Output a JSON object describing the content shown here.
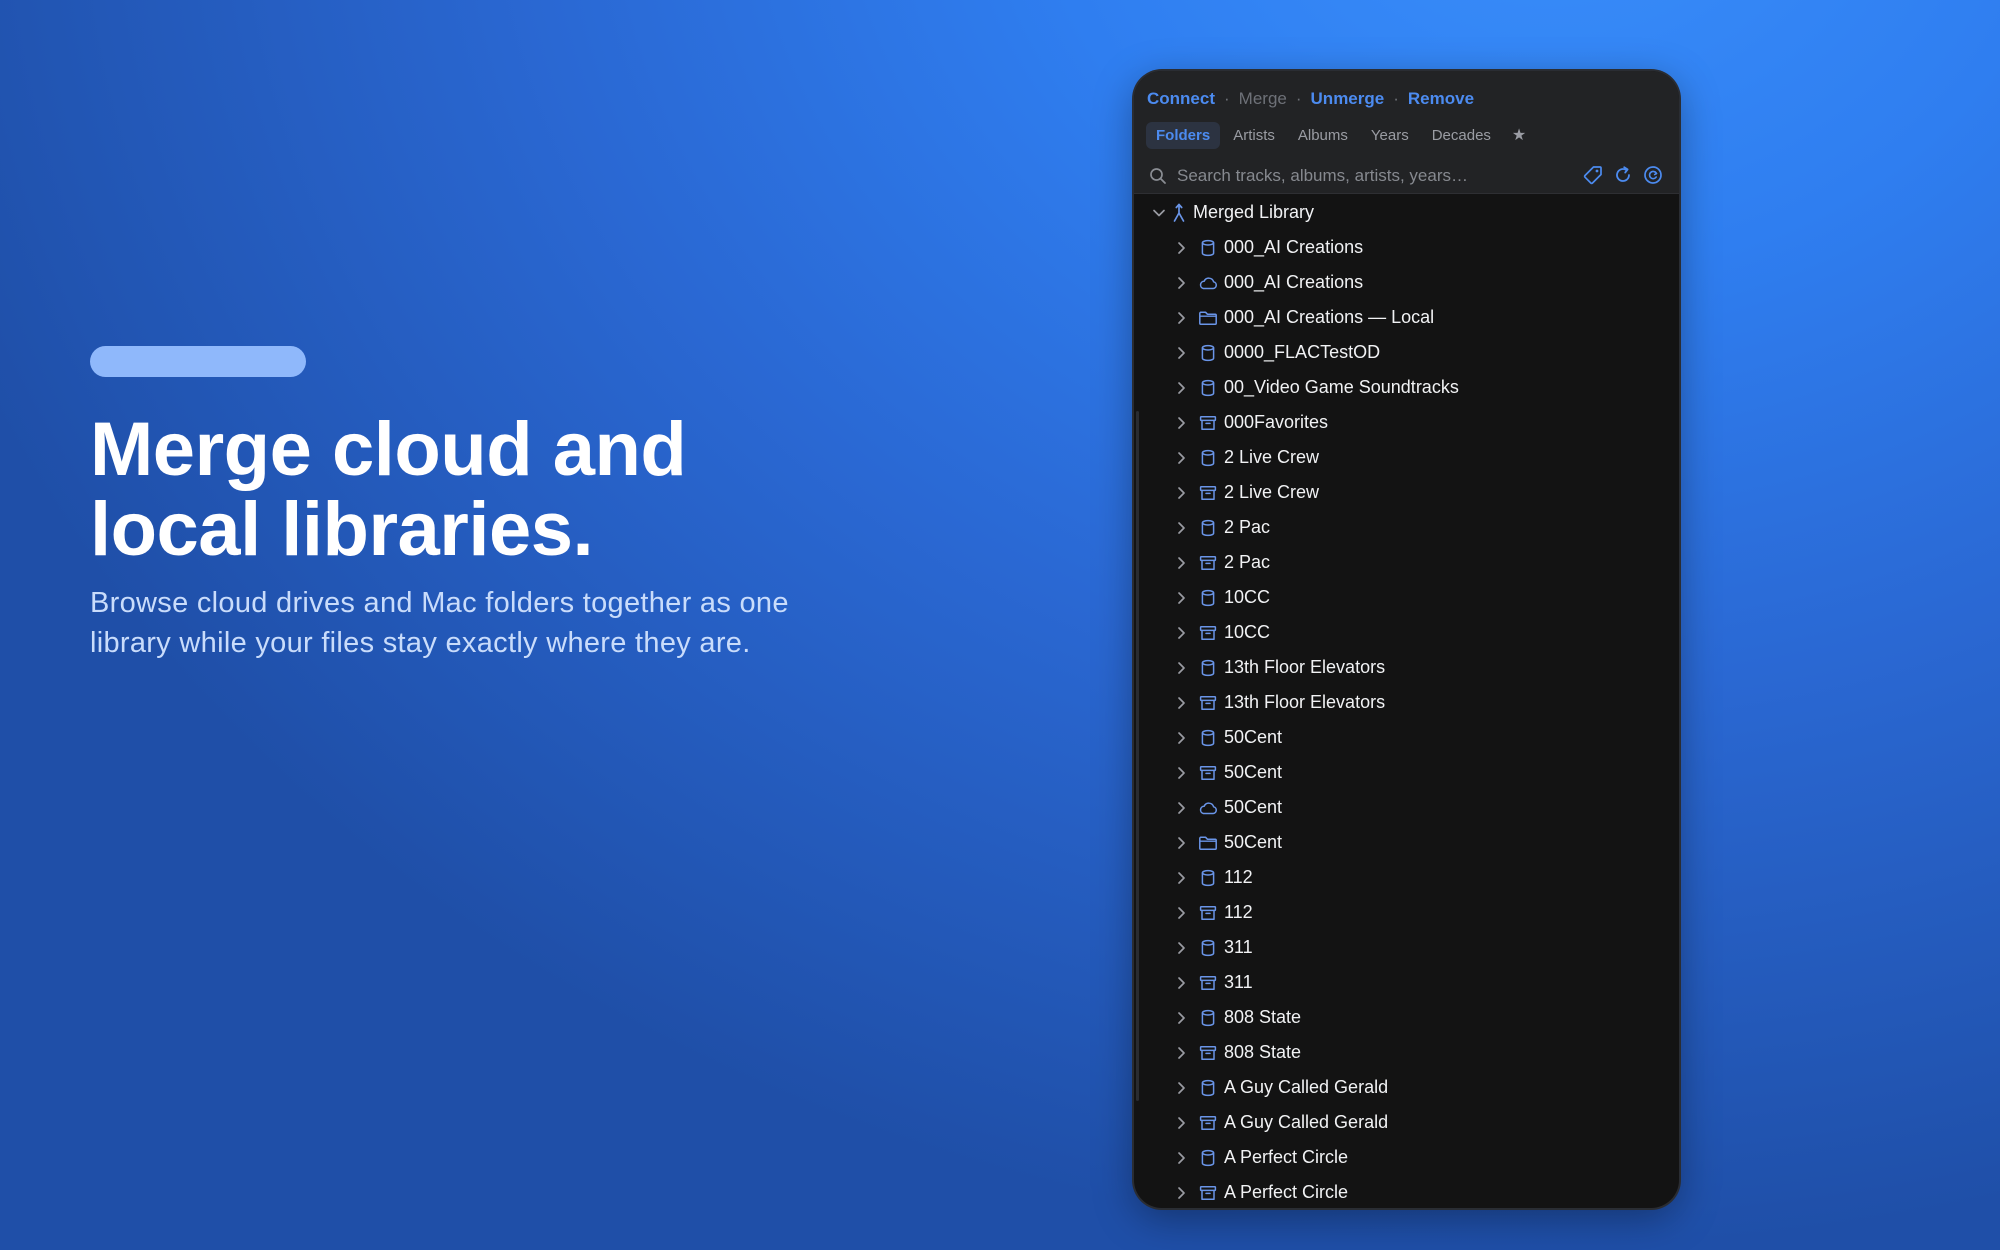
{
  "hero": {
    "title_line1": "Merge cloud and",
    "title_line2": "local libraries.",
    "subtitle": "Browse cloud drives and Mac folders together as one library while your files stay exactly where they are."
  },
  "panel": {
    "actions": {
      "connect": "Connect",
      "merge": "Merge",
      "unmerge": "Unmerge",
      "remove": "Remove",
      "separator": "·"
    },
    "tabs": [
      {
        "label": "Folders",
        "active": true
      },
      {
        "label": "Artists",
        "active": false
      },
      {
        "label": "Albums",
        "active": false
      },
      {
        "label": "Years",
        "active": false
      },
      {
        "label": "Decades",
        "active": false
      }
    ],
    "favorites_tab": "★",
    "search": {
      "placeholder": "Search tracks, albums, artists, years…",
      "value": ""
    },
    "tree": {
      "root_label": "Merged Library",
      "root_icon": "merge-icon",
      "items": [
        {
          "label": "000_AI Creations",
          "icon": "database"
        },
        {
          "label": "000_AI Creations",
          "icon": "cloud"
        },
        {
          "label": "000_AI Creations — Local",
          "icon": "folder"
        },
        {
          "label": "0000_FLACTestOD",
          "icon": "database"
        },
        {
          "label": "00_Video Game Soundtracks",
          "icon": "database"
        },
        {
          "label": "000Favorites",
          "icon": "archive"
        },
        {
          "label": "2 Live Crew",
          "icon": "database"
        },
        {
          "label": "2 Live Crew",
          "icon": "archive"
        },
        {
          "label": "2 Pac",
          "icon": "database"
        },
        {
          "label": "2 Pac",
          "icon": "archive"
        },
        {
          "label": "10CC",
          "icon": "database"
        },
        {
          "label": "10CC",
          "icon": "archive"
        },
        {
          "label": "13th Floor Elevators",
          "icon": "database"
        },
        {
          "label": "13th Floor Elevators",
          "icon": "archive"
        },
        {
          "label": "50Cent",
          "icon": "database"
        },
        {
          "label": "50Cent",
          "icon": "archive"
        },
        {
          "label": "50Cent",
          "icon": "cloud"
        },
        {
          "label": "50Cent",
          "icon": "folder"
        },
        {
          "label": "112",
          "icon": "database"
        },
        {
          "label": "112",
          "icon": "archive"
        },
        {
          "label": "311",
          "icon": "database"
        },
        {
          "label": "311",
          "icon": "archive"
        },
        {
          "label": "808 State",
          "icon": "database"
        },
        {
          "label": "808 State",
          "icon": "archive"
        },
        {
          "label": "A Guy Called Gerald",
          "icon": "database"
        },
        {
          "label": "A Guy Called Gerald",
          "icon": "archive"
        },
        {
          "label": "A Perfect Circle",
          "icon": "database"
        },
        {
          "label": "A Perfect Circle",
          "icon": "archive"
        }
      ]
    }
  },
  "colors": {
    "accent": "#4c8bf0",
    "panel_bg": "#131313",
    "panel_header_bg": "#222325",
    "icon_blue": "#6a95e8"
  }
}
